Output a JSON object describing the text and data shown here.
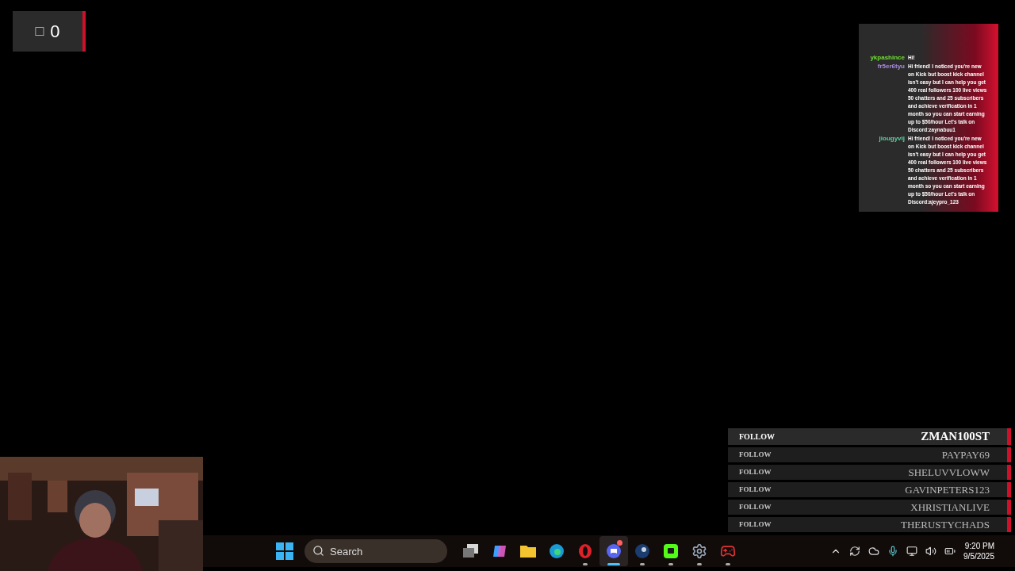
{
  "counter": {
    "icon": "□",
    "value": "0"
  },
  "chat": {
    "messages": [
      {
        "user": "ykpashince",
        "color": "#6ee030",
        "text": "Hi!"
      },
      {
        "user": "fr5er6tyu",
        "color": "#a98be0",
        "text": "Hi friend! I noticed you're new on Kick but boost kick channel isn't easy but I can help you get 400 real followers 100 live views 50 chatters and 25 subscribers and achieve verification in 1 month so you can start earning up to $50/hour Let's talk on Discord:zaynabuu1"
      },
      {
        "user": "jiougyvij",
        "color": "#5fd0a0",
        "text": "Hi friend! I noticed you're new on Kick but boost kick channel isn't easy but I can help you get 400 real followers 100 live views 50 chatters and 25 subscribers and achieve verification in 1 month so you can start earning up to $50/hour Let's talk on Discord:ajeypro_123"
      }
    ]
  },
  "followers": [
    {
      "label": "FOLLOW",
      "name": "ZMAN100ST",
      "latest": true
    },
    {
      "label": "FOLLOW",
      "name": "PAYPAY69",
      "latest": false
    },
    {
      "label": "FOLLOW",
      "name": "SHELUVVLOWW",
      "latest": false
    },
    {
      "label": "FOLLOW",
      "name": "GAVINPETERS123",
      "latest": false
    },
    {
      "label": "FOLLOW",
      "name": "XHRISTIANLIVE",
      "latest": false
    },
    {
      "label": "FOLLOW",
      "name": "THERUSTYCHADS",
      "latest": false
    }
  ],
  "taskbar": {
    "search": {
      "placeholder": "Search"
    },
    "apps": [
      {
        "kind": "taskview",
        "running": false,
        "active": false,
        "badge": false
      },
      {
        "kind": "copilot",
        "running": false,
        "active": false,
        "badge": false
      },
      {
        "kind": "folder",
        "running": false,
        "active": false,
        "badge": false
      },
      {
        "kind": "edge",
        "running": false,
        "active": false,
        "badge": false
      },
      {
        "kind": "opera",
        "running": true,
        "active": false,
        "badge": false
      },
      {
        "kind": "discord",
        "running": true,
        "active": true,
        "badge": true
      },
      {
        "kind": "steam",
        "running": true,
        "active": false,
        "badge": false
      },
      {
        "kind": "chat",
        "running": true,
        "active": false,
        "badge": false
      },
      {
        "kind": "settings",
        "running": true,
        "active": false,
        "badge": false
      },
      {
        "kind": "game",
        "running": true,
        "active": false,
        "badge": false
      }
    ],
    "tray": {
      "time": "9:20 PM",
      "date": "9/5/2025"
    }
  }
}
